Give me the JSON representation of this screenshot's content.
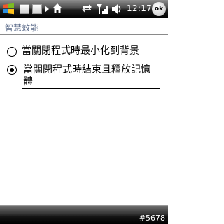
{
  "taskbar": {
    "clock": "12:17",
    "ok_label": "ok",
    "icons": [
      "windows-start-icon",
      "tab-icon",
      "tab-icon",
      "arrow-right-icon",
      "home-icon",
      "sync-icon",
      "signal-icon",
      "volume-icon"
    ]
  },
  "title": "智慧效能",
  "options": [
    {
      "label": "當關閉程式時最小化到背景",
      "checked": false
    },
    {
      "label": "當關閉程式時結束且釋放記憶體",
      "checked": true
    }
  ],
  "footer": {
    "tag": "#5678"
  }
}
